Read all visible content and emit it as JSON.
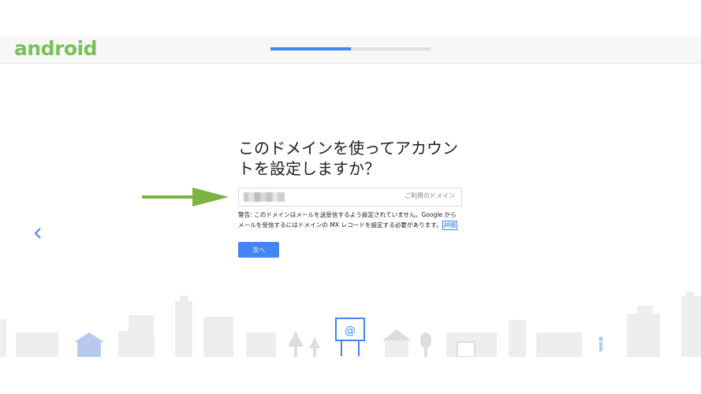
{
  "header": {
    "logo_text": "android",
    "progress": 0.5,
    "colors": {
      "logo": "#78c257",
      "progress_fill": "#4285f4",
      "progress_track": "#e0e0e0"
    }
  },
  "main": {
    "title_line1": "このドメインを使ってアカウン",
    "title_line2": "トを設定しますか？",
    "domain_field": {
      "label": "ご利用のドメイン",
      "value_obscured": true
    },
    "warning_line1": "警告: このドメインはメールを送受信するよう設定されていません。Google から",
    "warning_line2": "メールを受信するにはドメインの MX レコードを設定する必要があります。",
    "details_link": "詳細",
    "next_button": "次へ"
  },
  "icons": {
    "back": "chevron-left-icon",
    "annotation": "green-arrow-icon",
    "billboard_symbol": "@"
  },
  "accent_color": "#4285f4"
}
